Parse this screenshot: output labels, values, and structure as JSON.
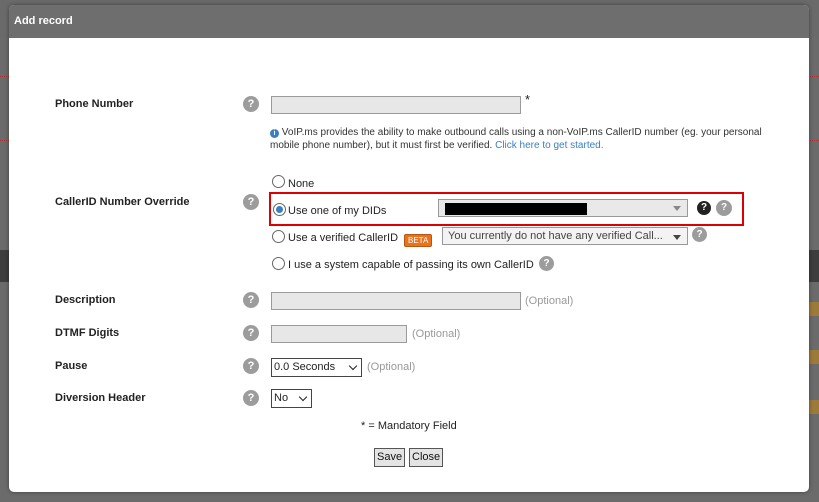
{
  "dialog": {
    "title": "Add record"
  },
  "fields": {
    "phone_number": {
      "label": "Phone Number",
      "value": "",
      "required_mark": "*"
    },
    "note": {
      "text": "VoIP.ms provides the ability to make outbound calls using a non-VoIP.ms CallerID number (eg. your personal mobile phone number), but it must first be verified.",
      "link": "Click here to get started."
    },
    "callerid_override": {
      "label": "CallerID Number Override",
      "options": {
        "none": "None",
        "did": "Use one of my DIDs",
        "verified": "Use a verified CallerID",
        "system": "I use a system capable of passing its own CallerID"
      },
      "selected": "did",
      "beta_badge": "BETA",
      "verified_select_value": "You currently do not have any verified Call..."
    },
    "description": {
      "label": "Description",
      "value": "",
      "hint": "(Optional)"
    },
    "dtmf": {
      "label": "DTMF Digits",
      "value": "",
      "hint": "(Optional)"
    },
    "pause": {
      "label": "Pause",
      "value": "0.0 Seconds",
      "hint": "(Optional)"
    },
    "diversion": {
      "label": "Diversion Header",
      "value": "No"
    }
  },
  "footer": {
    "mandatory_note": "* = Mandatory Field",
    "save_label": "Save",
    "close_label": "Close"
  },
  "icons": {
    "help": "?",
    "info": "i"
  },
  "colors": {
    "titlebar": "#6e6e6e",
    "link": "#3a7fc1",
    "highlight": "#dd0000",
    "beta": "#e8731e"
  }
}
